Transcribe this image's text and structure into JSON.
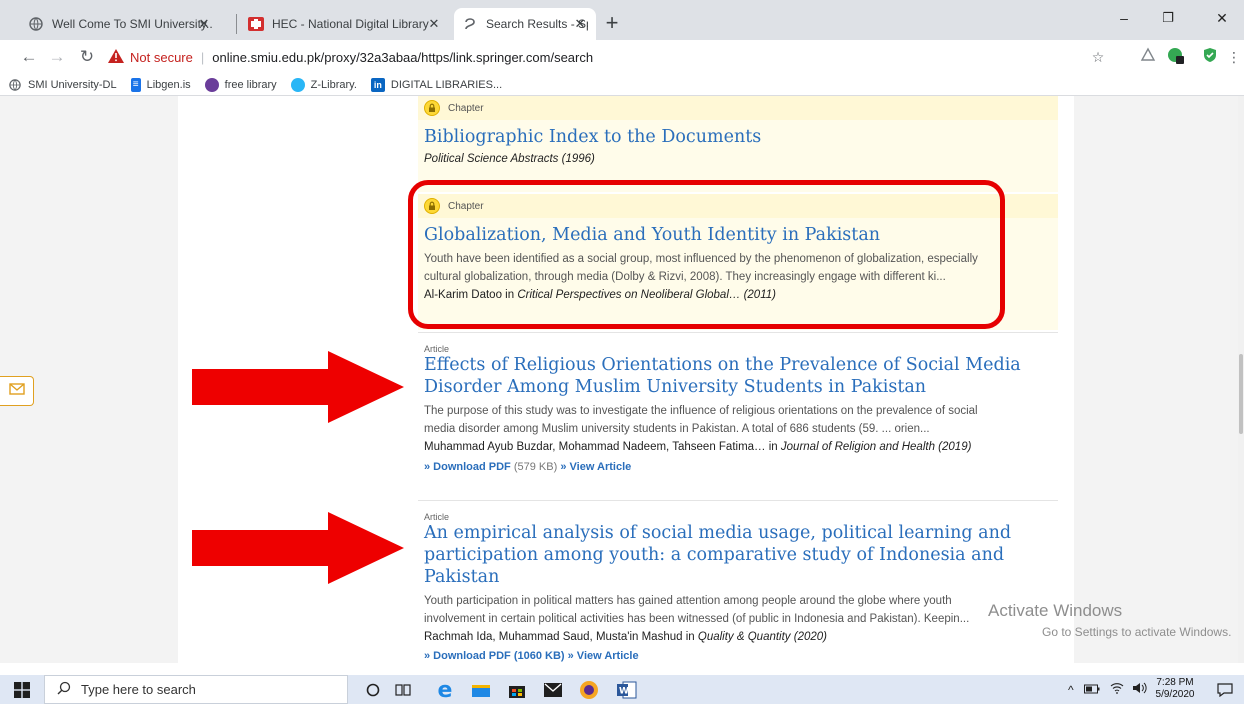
{
  "tabs": [
    {
      "title": "Well Come To SMI University...",
      "icon": "globe-icon"
    },
    {
      "title": "HEC - National Digital Library - P",
      "icon": "hec-logo-icon"
    },
    {
      "title": "Search Results - Springer",
      "icon": "springer-icon",
      "active": true
    }
  ],
  "window": {
    "minimize": "–",
    "restore": "❐",
    "close": "✕"
  },
  "address": {
    "not_secure": "Not secure",
    "url": "online.smiu.edu.pk/proxy/32a3abaa/https/link.springer.com/search"
  },
  "bookmarks": [
    {
      "label": "SMI University-DL",
      "icon": "globe-icon"
    },
    {
      "label": "Libgen.is",
      "icon": "libgen-icon"
    },
    {
      "label": "free library",
      "icon": "library-icon"
    },
    {
      "label": "Z-Library.",
      "icon": "zlibrary-icon"
    },
    {
      "label": "DIGITAL LIBRARIES...",
      "icon": "linkedin-icon"
    }
  ],
  "results": [
    {
      "type": "Chapter",
      "title": "Bibliographic Index to the Documents",
      "source": "Political Science Abstracts (1996)"
    },
    {
      "type": "Chapter",
      "title": "Globalization, Media and Youth Identity in Pakistan",
      "snippet_1": "Youth have been identified as a social group, most influenced by the phenomenon of globalization, especially",
      "snippet_2": "cultural globalization, through media (Dolby & Rizvi, 2008). They increasingly engage with different ki...",
      "authors": "Al-Karim Datoo in ",
      "source": "Critical Perspectives on Neoliberal Global… (2011)"
    },
    {
      "type": "Article",
      "title_1": "Effects of Religious Orientations on the Prevalence of Social Media",
      "title_2": "Disorder Among Muslim University Students in Pakistan",
      "snippet_1": "The purpose of this study was to investigate the influence of religious orientations on the prevalence of social",
      "snippet_2": "media disorder among Muslim university students in Pakistan. A total of 686 students (59. ... orien...",
      "authors": "Muhammad Ayub Buzdar, Mohammad Nadeem, Tahseen Fatima… in ",
      "source": "Journal of Religion and Health (2019)",
      "download": "» Download PDF",
      "size": "(579 KB)",
      "view": "» View Article"
    },
    {
      "type": "Article",
      "title_1": "An empirical analysis of social media usage, political learning and",
      "title_2": "participation among youth: a comparative study of Indonesia and",
      "title_3": "Pakistan",
      "snippet_1": "Youth participation in political matters has gained attention among people around the globe where youth",
      "snippet_2": "involvement in certain political activities has been witnessed (of public in Indonesia and Pakistan). Keepin...",
      "authors": "Rachmah Ida, Muhammad Saud, Musta'in Mashud in ",
      "source": "Quality & Quantity (2020)",
      "partial_links": "» Download PDF (1060 KB)  » View Article"
    }
  ],
  "watermark": {
    "line1": "Activate Windows",
    "line2": "Go to Settings to activate Windows."
  },
  "taskbar": {
    "search_placeholder": "Type here to search",
    "time": "7:28 PM",
    "date": "5/9/2020"
  },
  "colors": {
    "link": "#2a6ebb",
    "highlight": "#e60000",
    "locked_bg": "#fffcea"
  }
}
